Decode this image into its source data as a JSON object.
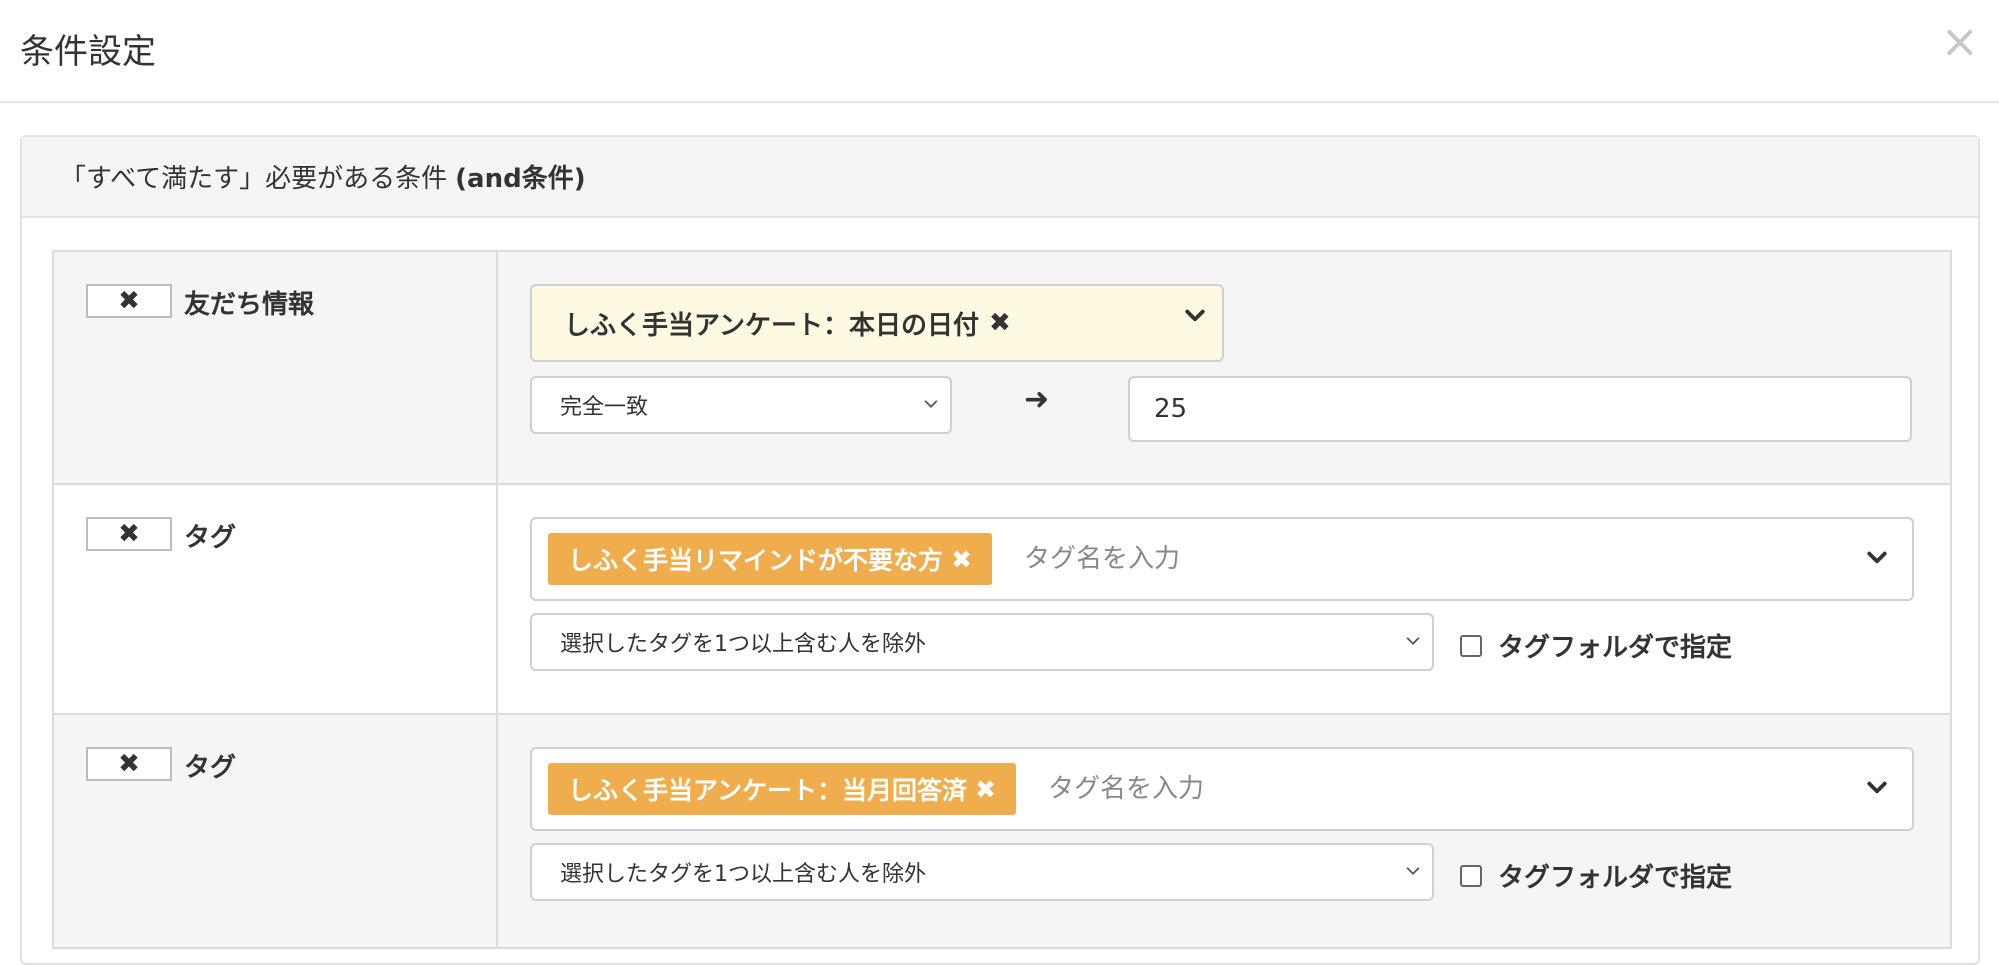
{
  "header": {
    "title": "条件設定",
    "close_icon": "×"
  },
  "panel": {
    "heading_prefix": "「すべて満たす」必要がある条件",
    "heading_suffix": "(and条件)"
  },
  "rows": [
    {
      "remove_label": "✖",
      "label": "友だち情報",
      "field_value": "しふく手当アンケート：本日の日付",
      "field_remove": "✖",
      "match_option": "完全一致",
      "arrow": "➜",
      "value": "25"
    },
    {
      "remove_label": "✖",
      "label": "タグ",
      "tag": "しふく手当リマインドが不要な方",
      "tag_remove": "✖",
      "tag_placeholder": "タグ名を入力",
      "mode_option": "選択したタグを1つ以上含む人を除外",
      "folder_label": "タグフォルダで指定"
    },
    {
      "remove_label": "✖",
      "label": "タグ",
      "tag": "しふく手当アンケート：当月回答済",
      "tag_remove": "✖",
      "tag_placeholder": "タグ名を入力",
      "mode_option": "選択したタグを1つ以上含む人を除外",
      "folder_label": "タグフォルダで指定"
    }
  ],
  "colors": {
    "tag_orange": "#f0ad4e",
    "chip_yellow": "#fef9e1",
    "row_shade": "#f5f5f5"
  }
}
